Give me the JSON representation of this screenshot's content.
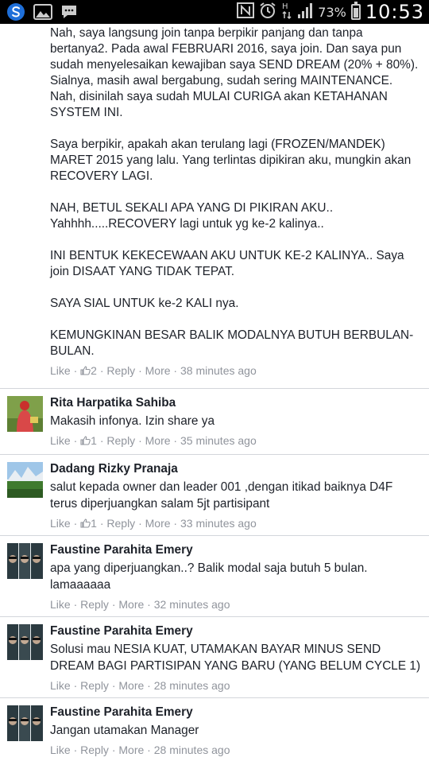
{
  "status_bar": {
    "battery": "73%",
    "time": "10:53",
    "battery_level": 0.73
  },
  "post": {
    "paragraphs": [
      "Nah, saya langsung join tanpa berpikir panjang dan tanpa bertanya2. Pada awal FEBRUARI 2016, saya join. Dan saya pun sudah menyelesaikan kewajiban saya SEND DREAM (20% + 80%). Sialnya, masih awal bergabung, sudah sering MAINTENANCE. Nah, disinilah saya sudah MULAI CURIGA akan KETAHANAN SYSTEM INI.",
      "Saya berpikir, apakah akan terulang lagi (FROZEN/MANDEK) MARET 2015 yang lalu. Yang terlintas dipikiran aku, mungkin akan RECOVERY LAGI.",
      "NAH, BETUL SEKALI APA YANG DI PIKIRAN AKU.. Yahhhh.....RECOVERY lagi untuk yg ke-2 kalinya..",
      "INI BENTUK KEKECEWAAN AKU UNTUK KE-2 KALINYA.. Saya join DISAAT YANG TIDAK TEPAT.",
      "SAYA SIAL UNTUK ke-2 KALI nya.",
      "KEMUNGKINAN BESAR BALIK MODALNYA BUTUH BERBULAN-BULAN."
    ],
    "like_label": "Like",
    "like_count": "2",
    "reply_label": "Reply",
    "more_label": "More",
    "time": "38 minutes ago"
  },
  "comments": [
    {
      "name": "Rita Harpatika Sahiba",
      "text": "Makasih infonya. Izin share ya",
      "like_label": "Like",
      "like_count": "1",
      "reply_label": "Reply",
      "more_label": "More",
      "time": "35 minutes ago"
    },
    {
      "name": "Dadang Rizky Pranaja",
      "text": "salut kepada owner dan leader 001 ,dengan itikad baiknya D4F terus diperjuangkan salam 5jt partisipant",
      "like_label": "Like",
      "like_count": "1",
      "reply_label": "Reply",
      "more_label": "More",
      "time": "33 minutes ago"
    },
    {
      "name": "Faustine Parahita Emery",
      "text": "apa yang diperjuangkan..? Balik modal saja butuh 5 bulan. lamaaaaaa",
      "like_label": "Like",
      "reply_label": "Reply",
      "more_label": "More",
      "time": "32 minutes ago"
    },
    {
      "name": "Faustine Parahita Emery",
      "text": "Solusi mau NESIA KUAT, UTAMAKAN BAYAR MINUS SEND DREAM BAGI PARTISIPAN YANG BARU (YANG BELUM CYCLE 1)",
      "like_label": "Like",
      "reply_label": "Reply",
      "more_label": "More",
      "time": "28 minutes ago"
    },
    {
      "name": "Faustine Parahita Emery",
      "text": "Jangan utamakan Manager",
      "like_label": "Like",
      "reply_label": "Reply",
      "more_label": "More",
      "time": "28 minutes ago"
    }
  ]
}
